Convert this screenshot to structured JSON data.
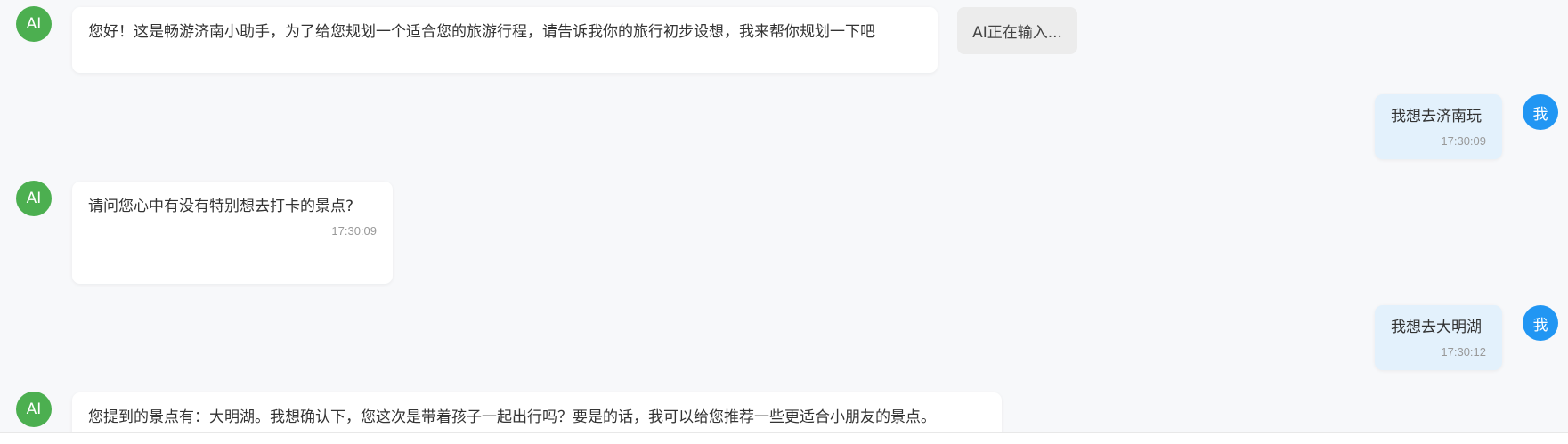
{
  "colors": {
    "ai_avatar": "#4caf50",
    "user_avatar": "#2196f3",
    "ai_bubble": "#ffffff",
    "user_bubble": "#e3f1fc",
    "background": "#f7f8fa"
  },
  "ai_avatar_label": "AI",
  "user_avatar_label": "我",
  "typing_indicator": "AI正在输入...",
  "messages": [
    {
      "sender": "ai",
      "text": "您好！这是畅游济南小助手，为了给您规划一个适合您的旅游行程，请告诉我你的旅行初步设想，我来帮你规划一下吧",
      "time": ""
    },
    {
      "sender": "user",
      "text": "我想去济南玩",
      "time": "17:30:09"
    },
    {
      "sender": "ai",
      "text": "请问您心中有没有特别想去打卡的景点?",
      "time": "17:30:09"
    },
    {
      "sender": "user",
      "text": "我想去大明湖",
      "time": "17:30:12"
    },
    {
      "sender": "ai",
      "text": "您提到的景点有：大明湖。我想确认下，您这次是带着孩子一起出行吗？要是的话，我可以给您推荐一些更适合小朋友的景点。",
      "time": ""
    }
  ]
}
